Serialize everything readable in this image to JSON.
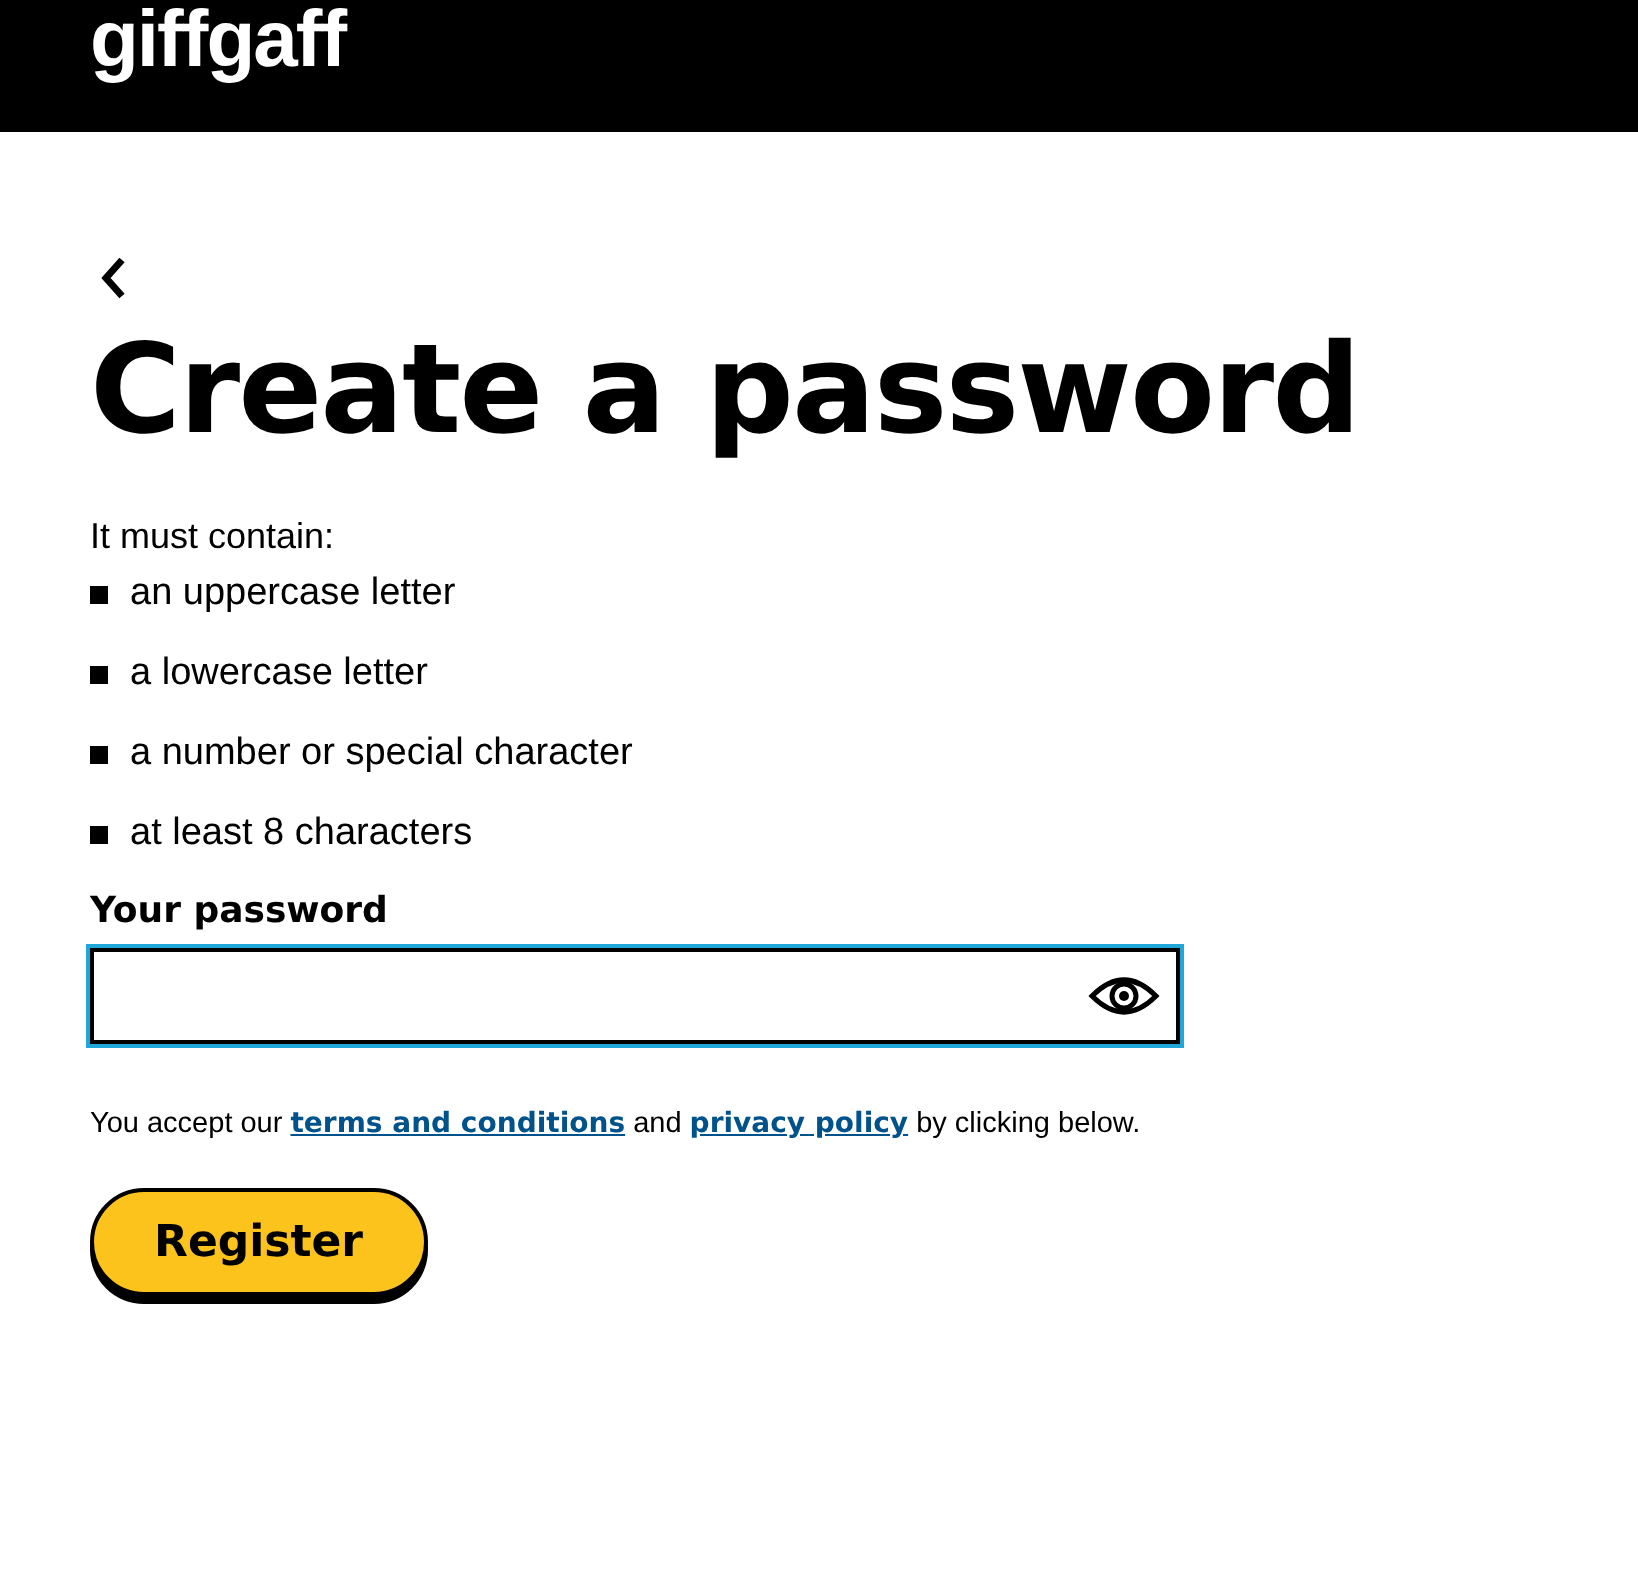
{
  "header": {
    "logo": "giffgaff"
  },
  "title": "Create a password",
  "requirements": {
    "intro": "It must contain:",
    "items": [
      "an uppercase letter",
      "a lowercase letter",
      "a number or special character",
      "at least 8 characters"
    ]
  },
  "password": {
    "label": "Your password",
    "focused": true
  },
  "terms": {
    "before": "You accept our",
    "link_1": "terms and conditions",
    "middle": "and",
    "link_2": "privacy policy",
    "after": "by clicking below."
  },
  "register_button": "Register"
}
